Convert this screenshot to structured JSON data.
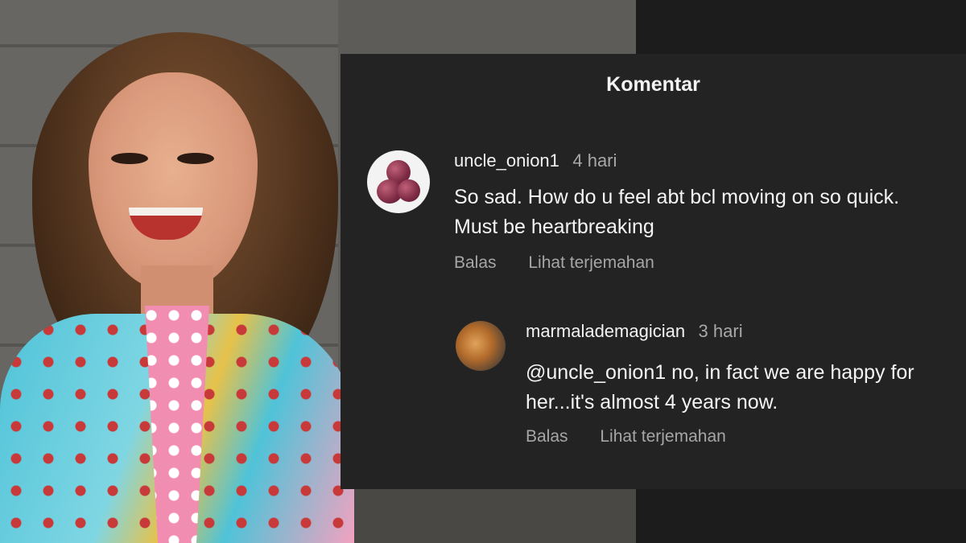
{
  "panel": {
    "title": "Komentar"
  },
  "comments": [
    {
      "username": "uncle_onion1",
      "time": "4 hari",
      "text": "So sad. How do u feel abt bcl moving on so quick. Must be heartbreaking",
      "reply_label": "Balas",
      "translate_label": "Lihat terjemahan"
    },
    {
      "username": "marmalademagician",
      "time": "3 hari",
      "text": "@uncle_onion1 no, in fact we are happy for her...it's almost 4 years now.",
      "reply_label": "Balas",
      "translate_label": "Lihat terjemahan"
    }
  ]
}
